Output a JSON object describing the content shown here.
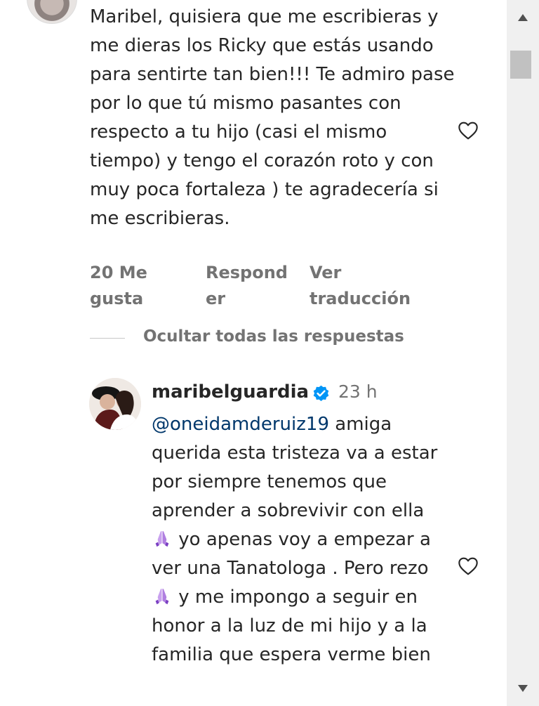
{
  "comment": {
    "text": "Maribel, quisiera que me escribieras y me dieras los Ricky que estás usando para sentirte tan bien!!! Te admiro pase por lo que tú mismo pasantes con respecto a tu hijo (casi el mismo tiempo) y tengo el corazón roto y con muy poca fortaleza ) te agradecería si me escribieras.",
    "likes": "20 Me\ngusta",
    "reply": "Respond\ner",
    "translate": "Ver\ntraducción"
  },
  "thread": {
    "hide_replies": "Ocultar todas las respuestas"
  },
  "reply": {
    "username": "maribelguardia",
    "timestamp": "23 h",
    "mention": "@oneidamderuiz19",
    "text_part1": " amiga querida esta tristeza va a estar por siempre tenemos que aprender a sobrevivir con ella ",
    "text_part2": " yo apenas voy a empezar a ver una Tanatologa . Pero rezo ",
    "text_part3": " y me impongo a seguir en honor a la luz de mi hijo y a la familia que espera verme bien"
  },
  "icons": {
    "heart": "heart-outline-icon",
    "verified": "verified-badge-icon",
    "praying_hands": "praying-hands-emoji"
  },
  "colors": {
    "text": "#262626",
    "muted": "#737373",
    "mention": "#00376b",
    "verified": "#0095f6"
  }
}
